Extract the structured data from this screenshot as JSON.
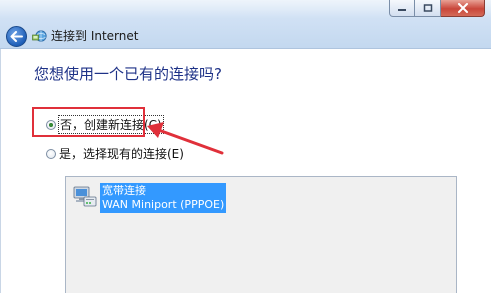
{
  "window": {
    "title": "连接到 Internet",
    "caption": {
      "minimize_glyph": "—",
      "maximize_glyph": "□",
      "close_glyph": "✕"
    }
  },
  "question": "您想使用一个已有的连接吗?",
  "options": [
    {
      "label": "否，创建新连接(C)",
      "selected": true
    },
    {
      "label": "是，选择现有的连接(E)",
      "selected": false
    }
  ],
  "connection_list": {
    "items": [
      {
        "name": "宽带连接",
        "device": "WAN Miniport (PPPOE)",
        "selected": true
      }
    ]
  },
  "annotation": {
    "color": "#e0303a"
  }
}
